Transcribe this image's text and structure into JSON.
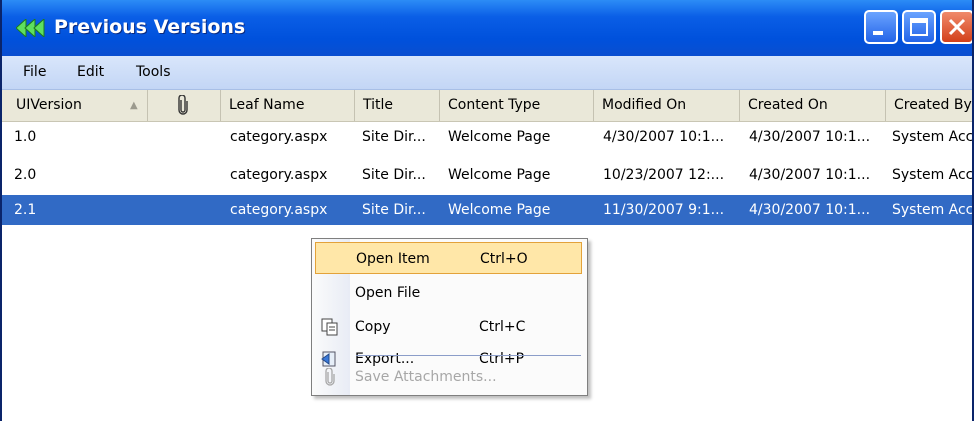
{
  "window": {
    "title": "Previous Versions"
  },
  "menubar": {
    "items": [
      "File",
      "Edit",
      "Tools"
    ]
  },
  "columns": [
    "UIVersion",
    "Leaf Name",
    "Title",
    "Content Type",
    "Modified On",
    "Created On",
    "Created By"
  ],
  "rows": [
    [
      "1.0",
      "category.aspx",
      "Site Dir...",
      "Welcome Page",
      "4/30/2007 10:1...",
      "4/30/2007 10:1...",
      "System Acc"
    ],
    [
      "2.0",
      "category.aspx",
      "Site Dir...",
      "Welcome Page",
      "10/23/2007 12:...",
      "4/30/2007 10:1...",
      "System Acc"
    ],
    [
      "2.1",
      "category.aspx",
      "Site Dir...",
      "Welcome Page",
      "11/30/2007 9:1...",
      "4/30/2007 10:1...",
      "System Acc"
    ]
  ],
  "context_menu": {
    "items": [
      {
        "label": "Open Item",
        "shortcut": "Ctrl+O",
        "icon": "",
        "state": "highlighted"
      },
      {
        "label": "Open File",
        "shortcut": "",
        "icon": "",
        "state": "normal"
      },
      {
        "label": "Copy",
        "shortcut": "Ctrl+C",
        "icon": "copy-icon",
        "state": "normal"
      },
      {
        "label": "Export...",
        "shortcut": "Ctrl+P",
        "icon": "export-icon",
        "state": "normal"
      },
      {
        "label": "Save Attachments...",
        "shortcut": "",
        "icon": "paperclip-icon",
        "state": "disabled"
      }
    ]
  },
  "colors": {
    "titlebar": "#0051dc",
    "selection": "#316ac5",
    "menu_highlight": "#ffe7a8",
    "close_button": "#d3401a"
  }
}
